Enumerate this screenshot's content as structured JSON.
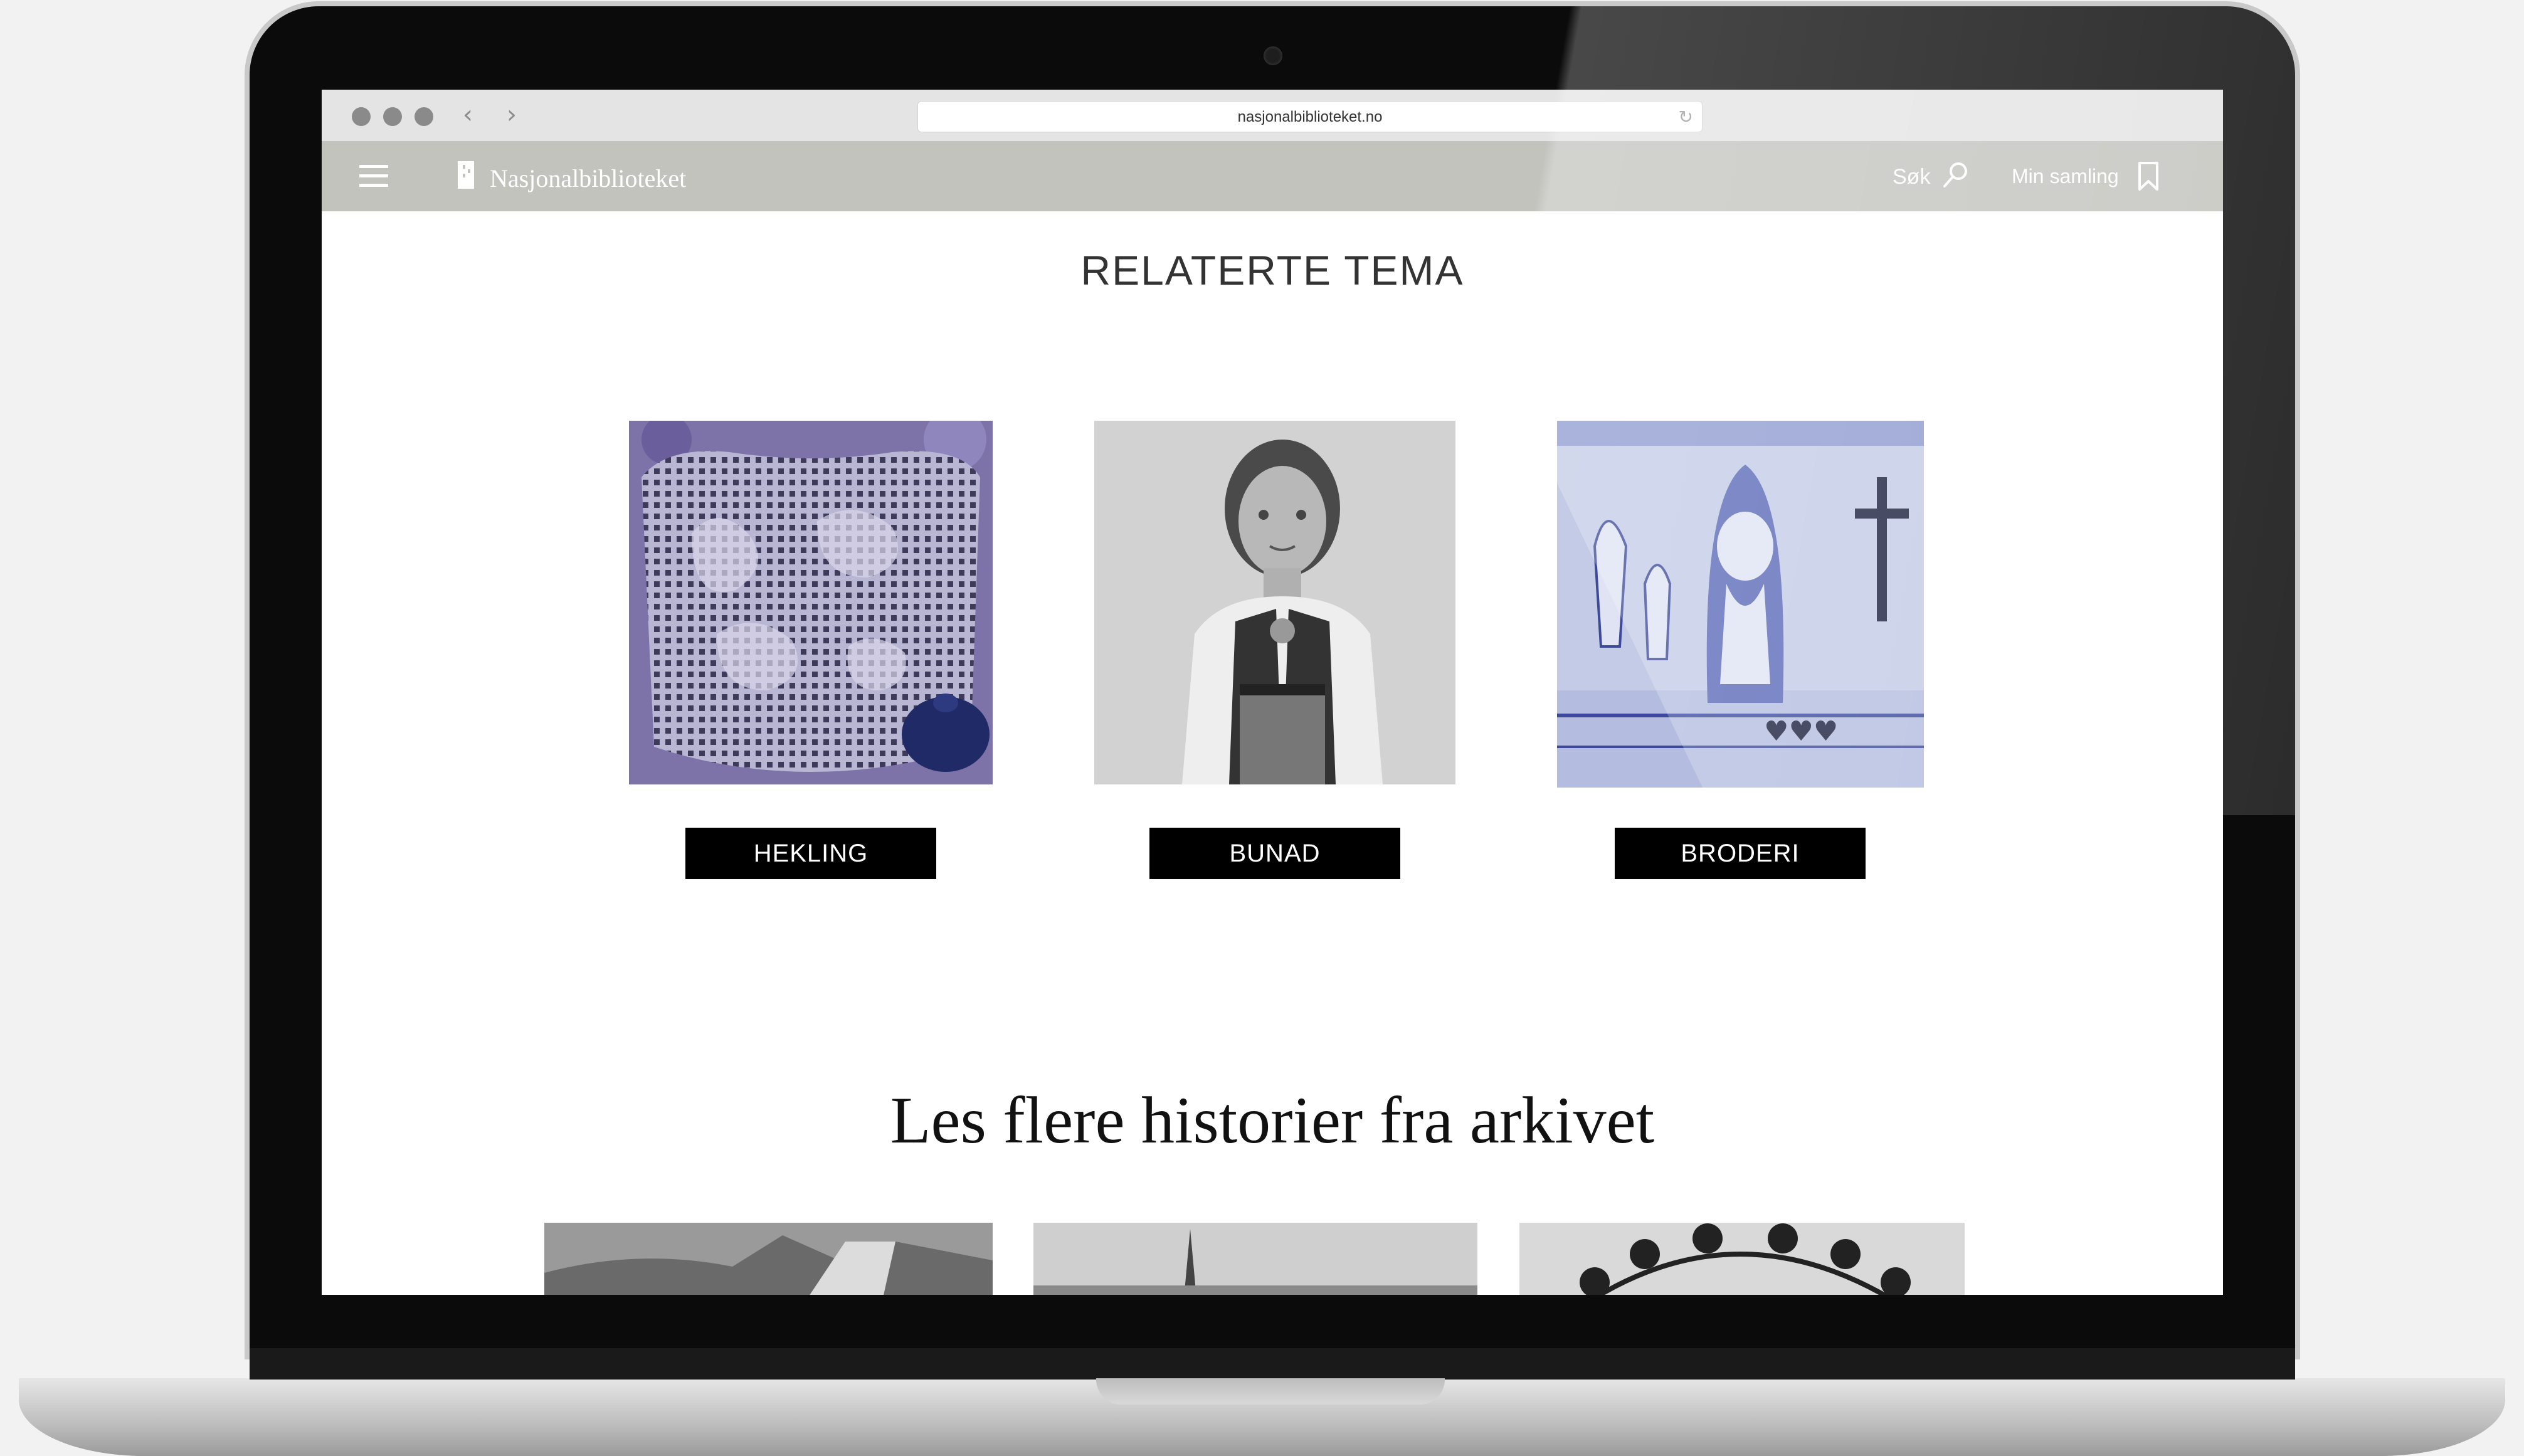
{
  "browser": {
    "url": "nasjonalbiblioteket.no",
    "back_icon": "chevron-left-icon",
    "forward_icon": "chevron-right-icon",
    "reload_icon": "reload-icon"
  },
  "header": {
    "menu_icon": "hamburger-menu-icon",
    "logo_text": "Nasjonalbiblioteket",
    "search_label": "Søk",
    "collection_label": "Min samling",
    "bg_color": "#c3c3be"
  },
  "related": {
    "title": "RELATERTE TEMA",
    "items": [
      {
        "label": "HEKLING",
        "image": "crocheted lace doily photo"
      },
      {
        "label": "BUNAD",
        "image": "portrait of woman in bunad"
      },
      {
        "label": "BRODERI",
        "image": "blue embroidery artwork"
      }
    ]
  },
  "stories": {
    "title": "Les flere historier fra arkivet"
  }
}
